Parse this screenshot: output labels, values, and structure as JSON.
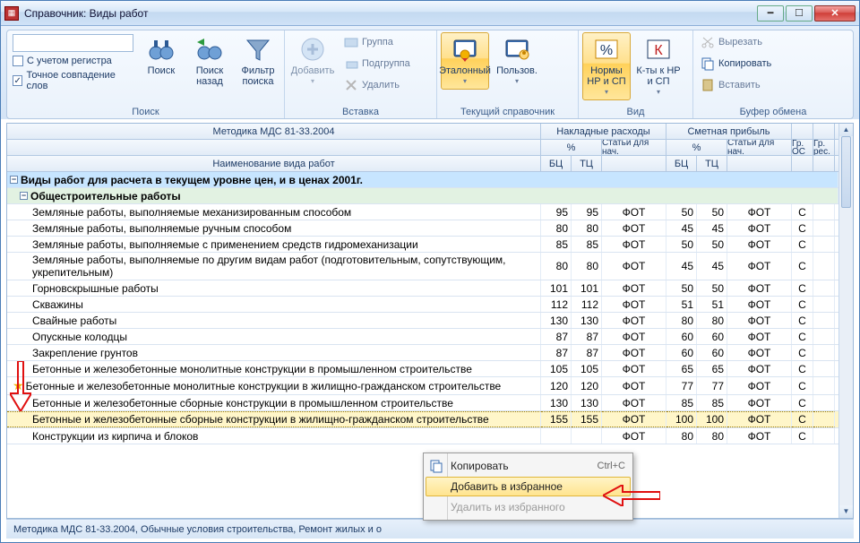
{
  "window": {
    "title": "Справочник: Виды работ"
  },
  "ribbon": {
    "search_group": {
      "label": "Поиск",
      "case_sensitive": "С учетом регистра",
      "exact_match": "Точное совпадение слов",
      "btn_search": "Поиск",
      "btn_back": "Поиск назад",
      "btn_filter": "Фильтр поиска"
    },
    "insert_group": {
      "label": "Вставка",
      "btn_add": "Добавить",
      "row_group": "Группа",
      "row_subgroup": "Подгруппа",
      "row_delete": "Удалить"
    },
    "current_group": {
      "label": "Текущий справочник",
      "btn_reference": "Эталонный",
      "btn_user": "Пользов."
    },
    "view_group": {
      "label": "Вид",
      "btn_norms": "Нормы НР и СП",
      "btn_coeff": "К-ты к НР и СП"
    },
    "clipboard_group": {
      "label": "Буфер обмена",
      "row_cut": "Вырезать",
      "row_copy": "Копировать",
      "row_paste": "Вставить"
    }
  },
  "grid": {
    "top_left": "Методика МДС 81-33.2004",
    "h_overhead": "Накладные расходы",
    "h_profit": "Сметная прибыль",
    "h_gros": "Гр. ОС",
    "h_gres": "Гр. рес.",
    "h_percent": "%",
    "h_articles": "Статьи для нач.",
    "h_name": "Наименование вида работ",
    "h_bc": "БЦ",
    "h_tc": "ТЦ",
    "group1": "Виды работ для расчета в текущем уровне цен, и в ценах 2001г.",
    "group2": "Общестроительные работы",
    "rows": [
      {
        "name": "Земляные работы, выполняемые механизированным способом",
        "bc1": "95",
        "tc1": "95",
        "s1": "ФОТ",
        "bc2": "50",
        "tc2": "50",
        "s2": "ФОТ",
        "g": "С"
      },
      {
        "name": "Земляные работы, выполняемые ручным способом",
        "bc1": "80",
        "tc1": "80",
        "s1": "ФОТ",
        "bc2": "45",
        "tc2": "45",
        "s2": "ФОТ",
        "g": "С"
      },
      {
        "name": "Земляные работы, выполняемые с применением средств гидромеханизации",
        "bc1": "85",
        "tc1": "85",
        "s1": "ФОТ",
        "bc2": "50",
        "tc2": "50",
        "s2": "ФОТ",
        "g": "С"
      },
      {
        "name": "Земляные работы, выполняемые по другим видам работ (подготовительным, сопутствующим, укрепительным)",
        "bc1": "80",
        "tc1": "80",
        "s1": "ФОТ",
        "bc2": "45",
        "tc2": "45",
        "s2": "ФОТ",
        "g": "С"
      },
      {
        "name": "Горновскрышные работы",
        "bc1": "101",
        "tc1": "101",
        "s1": "ФОТ",
        "bc2": "50",
        "tc2": "50",
        "s2": "ФОТ",
        "g": "С"
      },
      {
        "name": "Скважины",
        "bc1": "112",
        "tc1": "112",
        "s1": "ФОТ",
        "bc2": "51",
        "tc2": "51",
        "s2": "ФОТ",
        "g": "С"
      },
      {
        "name": "Свайные работы",
        "bc1": "130",
        "tc1": "130",
        "s1": "ФОТ",
        "bc2": "80",
        "tc2": "80",
        "s2": "ФОТ",
        "g": "С"
      },
      {
        "name": "Опускные колодцы",
        "bc1": "87",
        "tc1": "87",
        "s1": "ФОТ",
        "bc2": "60",
        "tc2": "60",
        "s2": "ФОТ",
        "g": "С"
      },
      {
        "name": "Закрепление грунтов",
        "bc1": "87",
        "tc1": "87",
        "s1": "ФОТ",
        "bc2": "60",
        "tc2": "60",
        "s2": "ФОТ",
        "g": "С"
      },
      {
        "name": "Бетонные и железобетонные монолитные конструкции в промышленном строительстве",
        "bc1": "105",
        "tc1": "105",
        "s1": "ФОТ",
        "bc2": "65",
        "tc2": "65",
        "s2": "ФОТ",
        "g": "С"
      },
      {
        "star": true,
        "name": "Бетонные и железобетонные монолитные конструкции в жилищно-гражданском строительстве",
        "bc1": "120",
        "tc1": "120",
        "s1": "ФОТ",
        "bc2": "77",
        "tc2": "77",
        "s2": "ФОТ",
        "g": "С"
      },
      {
        "name": "Бетонные и железобетонные сборные конструкции в промышленном строительстве",
        "bc1": "130",
        "tc1": "130",
        "s1": "ФОТ",
        "bc2": "85",
        "tc2": "85",
        "s2": "ФОТ",
        "g": "С"
      },
      {
        "selected": true,
        "name": "Бетонные и железобетонные сборные конструкции в жилищно-гражданском строительстве",
        "bc1": "155",
        "tc1": "155",
        "s1": "ФОТ",
        "bc2": "100",
        "tc2": "100",
        "s2": "ФОТ",
        "g": "С"
      },
      {
        "name": "Конструкции из кирпича и блоков",
        "bc1": "",
        "tc1": "",
        "s1": "ФОТ",
        "bc2": "80",
        "tc2": "80",
        "s2": "ФОТ",
        "g": "С"
      }
    ]
  },
  "context_menu": {
    "copy": "Копировать",
    "copy_shortcut": "Ctrl+C",
    "add_fav": "Добавить в избранное",
    "del_fav": "Удалить из избранного"
  },
  "status": "Методика МДС 81-33.2004, Обычные условия строительства, Ремонт жилых и о"
}
